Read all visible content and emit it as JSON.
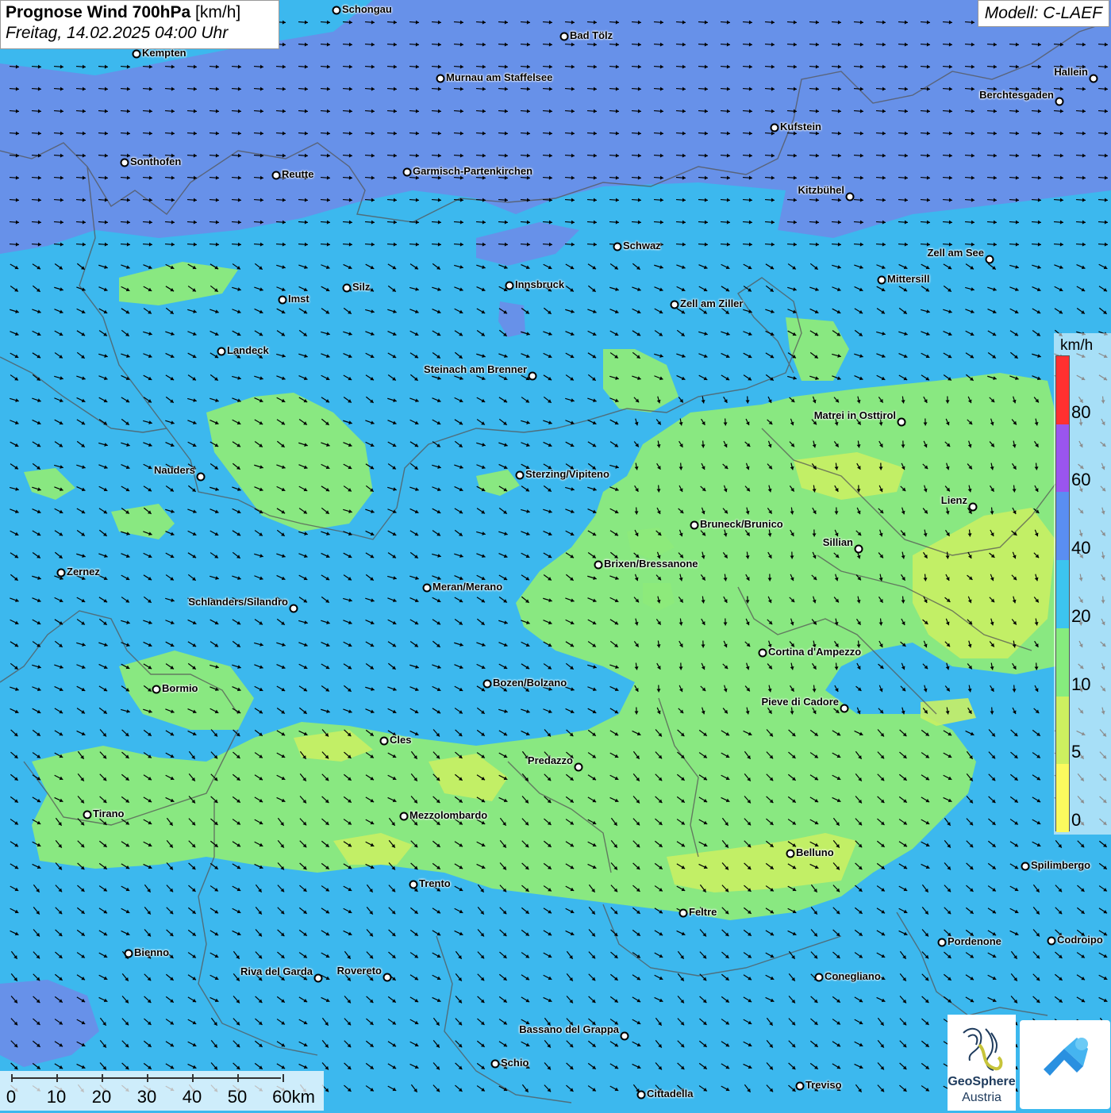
{
  "header": {
    "title_bold": "Prognose Wind 700hPa",
    "title_unit": "[km/h]",
    "subtitle": "Freitag, 14.02.2025 04:00 Uhr",
    "model": "Modell: C-LAEF"
  },
  "legend": {
    "unit": "km/h",
    "ticks": [
      "80",
      "60",
      "40",
      "20",
      "10",
      "5",
      "0"
    ],
    "colors": [
      "#ff3030",
      "#9a55ee",
      "#5a8ef2",
      "#3cc4f0",
      "#86ec7e",
      "#cdf060",
      "#fbfa5e"
    ]
  },
  "scale_bar": {
    "labels": [
      "0",
      "10",
      "20",
      "30",
      "40",
      "50",
      "60km"
    ]
  },
  "logos": {
    "geosphere_line1": "GeoSphere",
    "geosphere_line2": "Austria"
  },
  "cities": [
    {
      "name": "Schongau"
    },
    {
      "name": "Bad Tölz"
    },
    {
      "name": "Kempten"
    },
    {
      "name": "Murnau am Staffelsee"
    },
    {
      "name": "Hallein"
    },
    {
      "name": "Berchtesgaden"
    },
    {
      "name": "Kufstein"
    },
    {
      "name": "Sonthofen"
    },
    {
      "name": "Reutte"
    },
    {
      "name": "Garmisch-Partenkirchen"
    },
    {
      "name": "Kitzbühel"
    },
    {
      "name": "Schwaz"
    },
    {
      "name": "Zell am See"
    },
    {
      "name": "Mittersill"
    },
    {
      "name": "Innsbruck"
    },
    {
      "name": "Silz"
    },
    {
      "name": "Imst"
    },
    {
      "name": "Zell am Ziller"
    },
    {
      "name": "Landeck"
    },
    {
      "name": "Steinach am Brenner"
    },
    {
      "name": "Matrei in Osttirol"
    },
    {
      "name": "Nauders"
    },
    {
      "name": "Sterzing/Vipiteno"
    },
    {
      "name": "Lienz"
    },
    {
      "name": "Bruneck/Brunico"
    },
    {
      "name": "Sillian"
    },
    {
      "name": "Brixen/Bressanone"
    },
    {
      "name": "Zernez"
    },
    {
      "name": "Meran/Merano"
    },
    {
      "name": "Schlanders/Silandro"
    },
    {
      "name": "Cortina d'Ampezzo"
    },
    {
      "name": "Bozen/Bolzano"
    },
    {
      "name": "Bormio"
    },
    {
      "name": "Pieve di Cadore"
    },
    {
      "name": "Cles"
    },
    {
      "name": "Predazzo"
    },
    {
      "name": "Tirano"
    },
    {
      "name": "Mezzolombardo"
    },
    {
      "name": "Belluno"
    },
    {
      "name": "Spilimbergo"
    },
    {
      "name": "Trento"
    },
    {
      "name": "Feltre"
    },
    {
      "name": "Pordenone"
    },
    {
      "name": "Codroipo"
    },
    {
      "name": "Bienno"
    },
    {
      "name": "Riva del Garda"
    },
    {
      "name": "Rovereto"
    },
    {
      "name": "Conegliano"
    },
    {
      "name": "Bassano del Grappa"
    },
    {
      "name": "Schio"
    },
    {
      "name": "Treviso"
    },
    {
      "name": "Cittadella"
    }
  ]
}
